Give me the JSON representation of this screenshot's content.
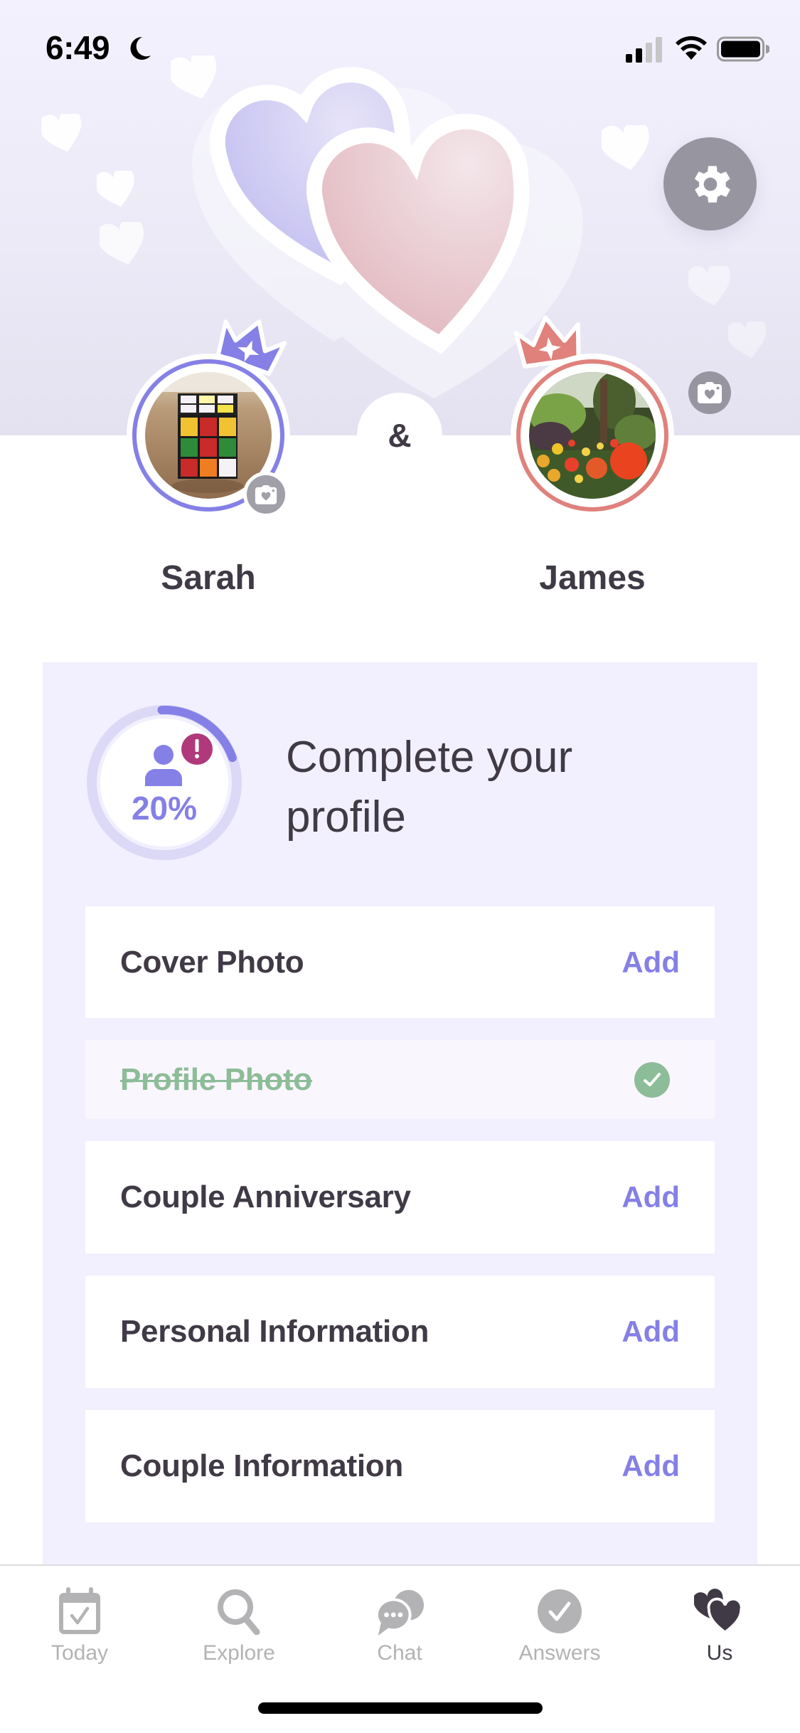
{
  "status_bar": {
    "time": "6:49",
    "icons": [
      "moon-icon",
      "signal-icon",
      "wifi-icon",
      "battery-icon"
    ]
  },
  "header": {
    "settings_icon": "gear-icon",
    "cover_photo_icon": "camera-heart-icon"
  },
  "couple": {
    "separator": "&",
    "partners": [
      {
        "name": "Sarah",
        "ring_color": "#8580e6",
        "crown_color": "#8580e6",
        "photo": "rubiks-cube-photo",
        "has_camera_badge": true
      },
      {
        "name": "James",
        "ring_color": "#e0817c",
        "crown_color": "#e0817c",
        "photo": "garden-flowers-photo",
        "has_camera_badge": false
      }
    ]
  },
  "profile_card": {
    "progress_percent": 20,
    "progress_label": "20%",
    "alert_icon": "exclamation-icon",
    "title": "Complete your profile",
    "tasks": [
      {
        "label": "Cover Photo",
        "action": "Add",
        "done": false
      },
      {
        "label": "Profile Photo",
        "action": "",
        "done": true
      },
      {
        "label": "Couple Anniversary",
        "action": "Add",
        "done": false
      },
      {
        "label": "Personal Information",
        "action": "Add",
        "done": false
      },
      {
        "label": "Couple Information",
        "action": "Add",
        "done": false
      }
    ]
  },
  "tab_bar": {
    "tabs": [
      {
        "label": "Today",
        "icon": "calendar-check-icon",
        "active": false
      },
      {
        "label": "Explore",
        "icon": "search-icon",
        "active": false
      },
      {
        "label": "Chat",
        "icon": "chat-bubbles-icon",
        "active": false
      },
      {
        "label": "Answers",
        "icon": "check-circle-icon",
        "active": false
      },
      {
        "label": "Us",
        "icon": "hearts-icon",
        "active": true
      }
    ]
  },
  "colors": {
    "accent_purple": "#8580e6",
    "accent_coral": "#e0817c",
    "done_green": "#8dbd98",
    "alert_magenta": "#b0397c",
    "text_dark": "#3f3a45",
    "tab_inactive": "#b3b3b6",
    "card_bg": "#f2f0fe"
  }
}
